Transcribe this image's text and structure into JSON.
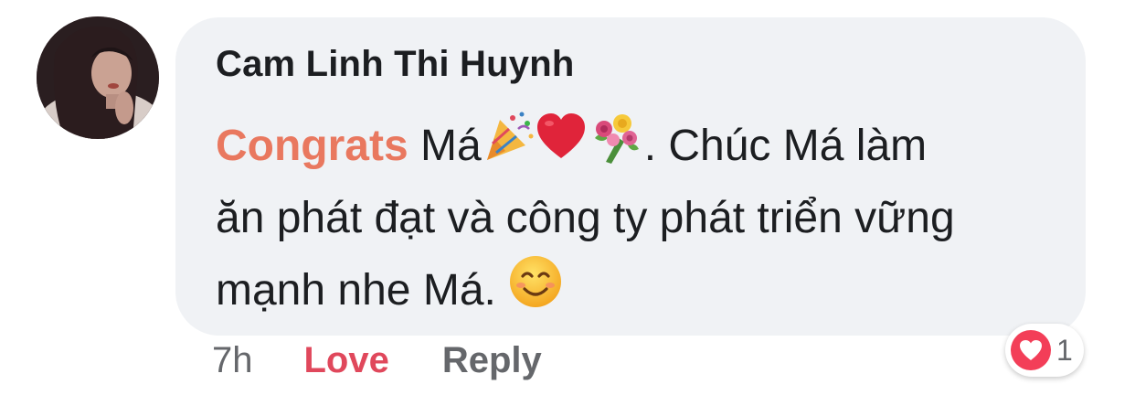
{
  "comment": {
    "author": "Cam Linh Thi Huynh",
    "body": {
      "highlight": "Congrats",
      "line1_after": " Má",
      "line1_tail": ". Chúc Má làm",
      "line2": "ăn phát đạt và công ty phát triển vững",
      "line3": "mạnh nhe Má. ",
      "emoji_icons": [
        "party-popper-icon",
        "red-heart-icon",
        "bouquet-icon",
        "smiling-face-icon"
      ]
    },
    "actions": {
      "time": "7h",
      "love": "Love",
      "reply": "Reply"
    },
    "reactions": {
      "icon": "heart-reaction-icon",
      "count": "1"
    },
    "colors": {
      "bubble": "#f0f2f5",
      "highlight": "#e9785f",
      "love": "#e0485c",
      "secondary": "#65676b",
      "reaction_badge": "#f33e58"
    }
  }
}
